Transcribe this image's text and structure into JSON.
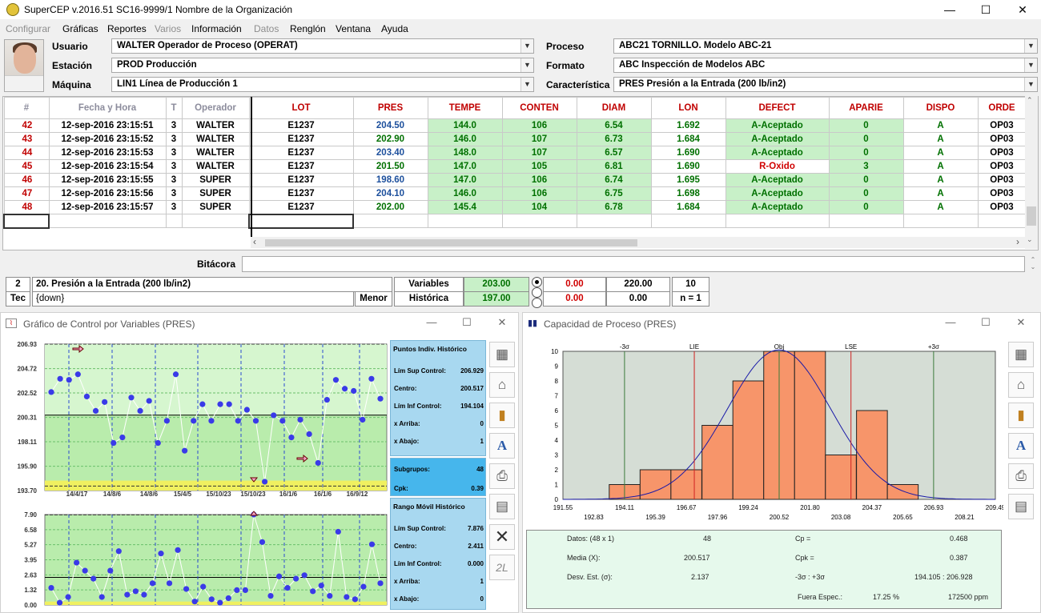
{
  "window": {
    "title": "SuperCEP v.2016.51  SC16-9999/1  Nombre de la Organización",
    "minimize": "—",
    "maximize": "☐",
    "close": "✕"
  },
  "menu": [
    {
      "label": "Configurar",
      "disabled": true
    },
    {
      "label": "Gráficas",
      "disabled": false
    },
    {
      "label": "Reportes",
      "disabled": false
    },
    {
      "label": "Varios",
      "disabled": true
    },
    {
      "label": "Información",
      "disabled": false
    },
    {
      "label": "Datos",
      "disabled": true
    },
    {
      "label": "Renglón",
      "disabled": false
    },
    {
      "label": "Ventana",
      "disabled": false
    },
    {
      "label": "Ayuda",
      "disabled": false
    }
  ],
  "form": {
    "usuario_label": "Usuario",
    "usuario_value": "WALTER  Operador de Proceso (OPERAT)",
    "estacion_label": "Estación",
    "estacion_value": "PROD  Producción",
    "maquina_label": "Máquina",
    "maquina_value": "LIN1  Línea de Producción 1",
    "proceso_label": "Proceso",
    "proceso_value": "ABC21  TORNILLO. Modelo ABC-21",
    "formato_label": "Formato",
    "formato_value": "ABC  Inspección de Modelos ABC",
    "caracteristica_label": "Característica",
    "caracteristica_value": "PRES  Presión a la Entrada (200 lb/in2)"
  },
  "grid": {
    "columns": [
      "#",
      "Fecha y Hora",
      "T",
      "Operador",
      "LOT",
      "PRES",
      "TEMPE",
      "CONTEN",
      "DIAM",
      "LON",
      "DEFECT",
      "APARIE",
      "DISPO",
      "ORDE"
    ],
    "rows": [
      [
        "42",
        "12-sep-2016  23:15:51",
        "3",
        "WALTER",
        "E1237",
        "204.50",
        "144.0",
        "106",
        "6.54",
        "1.692",
        "A-Aceptado",
        "0",
        "A",
        "OP03"
      ],
      [
        "43",
        "12-sep-2016  23:15:52",
        "3",
        "WALTER",
        "E1237",
        "202.90",
        "146.0",
        "107",
        "6.73",
        "1.684",
        "A-Aceptado",
        "0",
        "A",
        "OP03"
      ],
      [
        "44",
        "12-sep-2016  23:15:53",
        "3",
        "WALTER",
        "E1237",
        "203.40",
        "148.0",
        "107",
        "6.57",
        "1.690",
        "A-Aceptado",
        "0",
        "A",
        "OP03"
      ],
      [
        "45",
        "12-sep-2016  23:15:54",
        "3",
        "WALTER",
        "E1237",
        "201.50",
        "147.0",
        "105",
        "6.81",
        "1.690",
        "R-Oxido",
        "3",
        "A",
        "OP03"
      ],
      [
        "46",
        "12-sep-2016  23:15:55",
        "3",
        "SUPER",
        "E1237",
        "198.60",
        "147.0",
        "106",
        "6.74",
        "1.695",
        "A-Aceptado",
        "0",
        "A",
        "OP03"
      ],
      [
        "47",
        "12-sep-2016  23:15:56",
        "3",
        "SUPER",
        "E1237",
        "204.10",
        "146.0",
        "106",
        "6.75",
        "1.698",
        "A-Aceptado",
        "0",
        "A",
        "OP03"
      ],
      [
        "48",
        "12-sep-2016  23:15:57",
        "3",
        "SUPER",
        "E1237",
        "202.00",
        "145.4",
        "104",
        "6.78",
        "1.684",
        "A-Aceptado",
        "0",
        "A",
        "OP03"
      ]
    ]
  },
  "bitacora": {
    "label": "Bitácora",
    "value": ""
  },
  "status": {
    "num": "2",
    "char_name": "20. Presión a la Entrada (200 lb/in2)",
    "tec": "Tec",
    "tec_value": "{down}",
    "menor": "Menor",
    "variables_label": "Variables",
    "variables_value": "203.00",
    "historica_label": "Histórica",
    "historica_value": "197.00",
    "v1": "0.00",
    "v2": "220.00",
    "v3": "10",
    "h1": "0.00",
    "h2": "0.00",
    "h3": "n = 1"
  },
  "control_window": {
    "title": "Gráfico de Control por Variables (PRES)",
    "y_ticks": [
      "206.93",
      "204.72",
      "202.52",
      "200.31",
      "198.11",
      "195.90",
      "193.70"
    ],
    "x_ticks": [
      "14/4/17",
      "14/8/6",
      "14/8/6",
      "15/4/5",
      "15/10/23",
      "15/10/23",
      "16/1/6",
      "16/1/6",
      "16/9/12"
    ],
    "mr_ticks": [
      "7.90",
      "6.58",
      "5.27",
      "3.95",
      "2.63",
      "1.32",
      "0.00"
    ],
    "indiv_panel": {
      "header": "Puntos Indiv. Histórico",
      "rows": [
        [
          "Lím Sup Control:",
          "206.929"
        ],
        [
          "Centro:",
          "200.517"
        ],
        [
          "Lím Inf Control:",
          "194.104"
        ],
        [
          "x Arriba:",
          "0"
        ],
        [
          "x Abajo:",
          "1"
        ]
      ]
    },
    "subgroups": {
      "label": "Subgrupos:",
      "value": "48",
      "cpk_label": "Cpk:",
      "cpk_value": "0.39"
    },
    "mr_panel": {
      "header": "Rango Móvil Histórico",
      "rows": [
        [
          "Lím Sup Control:",
          "7.876"
        ],
        [
          "Centro:",
          "2.411"
        ],
        [
          "Lím Inf Control:",
          "0.000"
        ],
        [
          "x Arriba:",
          "1"
        ],
        [
          "x Abajo:",
          "0"
        ]
      ]
    }
  },
  "chart_data": [
    {
      "type": "line",
      "title": "Gráfico de Control por Variables (PRES)",
      "ylim": [
        193.7,
        206.93
      ],
      "center": 200.517,
      "ucl": 206.929,
      "lcl": 194.104,
      "values": [
        202.6,
        203.8,
        203.7,
        204.2,
        202.2,
        200.9,
        201.7,
        198.0,
        198.5,
        202.1,
        200.9,
        201.8,
        198.0,
        200.0,
        204.2,
        197.3,
        200.0,
        201.5,
        200.0,
        201.5,
        201.5,
        200.0,
        201.0,
        200.0,
        194.5,
        200.5,
        200.0,
        198.5,
        200.1,
        198.8,
        196.2,
        201.9,
        203.7,
        202.9,
        202.7,
        200.1,
        203.8,
        202.0
      ]
    },
    {
      "type": "line",
      "title": "Rango Móvil",
      "ylim": [
        0,
        7.9
      ],
      "center": 2.411,
      "ucl": 7.876,
      "lcl": 0,
      "values": [
        1.5,
        0.2,
        0.7,
        3.7,
        3.0,
        2.3,
        0.7,
        3.0,
        4.7,
        0.9,
        1.2,
        0.9,
        1.9,
        4.5,
        1.9,
        4.8,
        1.4,
        0.3,
        1.6,
        0.5,
        0.2,
        0.6,
        1.3,
        1.3,
        7.9,
        5.5,
        0.8,
        2.5,
        1.5,
        2.3,
        2.6,
        1.2,
        1.7,
        0.8,
        6.4,
        0.7,
        0.5,
        1.6,
        5.3,
        1.9
      ]
    },
    {
      "type": "bar",
      "title": "Capacidad de Proceso (PRES)",
      "ylim": [
        0,
        10
      ],
      "categories": [
        "192.83",
        "194.11",
        "195.39",
        "196.67",
        "197.96",
        "199.24",
        "200.52",
        "201.80",
        "203.08",
        "204.37",
        "205.65"
      ],
      "values": [
        0,
        1,
        2,
        2,
        5,
        8,
        10,
        10,
        3,
        6,
        1
      ],
      "x_ticks_top": [
        "191.55",
        "194.11",
        "196.67",
        "199.24",
        "201.80",
        "204.37",
        "206.93",
        "209.49"
      ],
      "x_ticks_bottom": [
        "192.83",
        "195.39",
        "197.96",
        "200.52",
        "203.08",
        "205.65",
        "208.21"
      ],
      "y_ticks": [
        "10",
        "9",
        "8",
        "7",
        "6",
        "5",
        "4",
        "3",
        "2",
        "1",
        "0"
      ],
      "markers": [
        "-3σ",
        "LIE",
        "Obj",
        "LSE",
        "+3σ"
      ]
    }
  ],
  "capacity_window": {
    "title": "Capacidad de Proceso (PRES)",
    "datos_label": "Datos:  (48 x 1)",
    "datos_value": "48",
    "media_label": "Media (X):",
    "media_value": "200.517",
    "desv_label": "Desv. Est. (σ):",
    "desv_value": "2.137",
    "cp_label": "Cp =",
    "cp_value": "0.468",
    "cpk_label": "Cpk =",
    "cpk_value": "0.387",
    "sigma_label": "-3σ :  +3σ",
    "sigma_value": "194.105 : 206.928",
    "fuera_label": "Fuera Espec.:",
    "fuera_pct": "17.25 %",
    "fuera_ppm": "172500 ppm"
  },
  "colors": {
    "green_fill": "#c8f0c8",
    "panel_blue": "#a8d8f0",
    "bar_orange": "#f7956a",
    "accent_red": "#c00000"
  }
}
